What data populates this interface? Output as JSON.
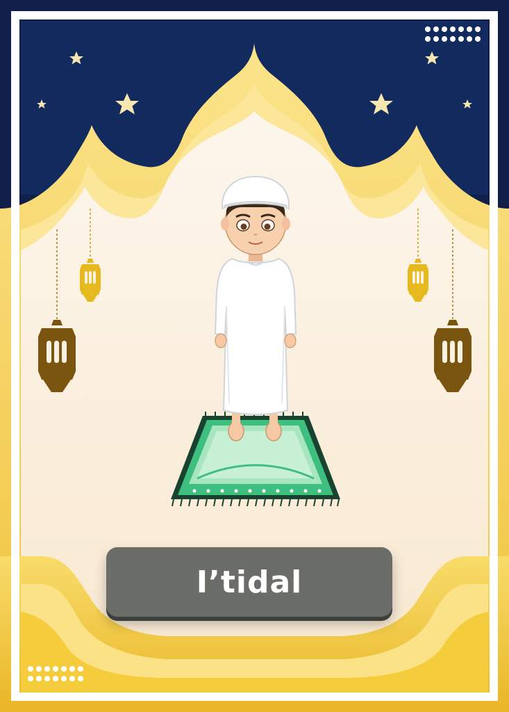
{
  "card": {
    "title": "I’tidal"
  },
  "colors": {
    "sky": "#0f1f4a",
    "gold": "#f3cc3b",
    "gold_light": "#fbe38a",
    "cream": "#fbf1e2",
    "lantern_gold": "#e6b91e",
    "lantern_brown": "#7a5510",
    "mat_green": "#3fbf7f",
    "mat_dark": "#17432f",
    "label_bg": "#6b6d69"
  },
  "icons": [
    "star-icon",
    "dot-grid-icon",
    "lantern-icon",
    "prayer-mat-icon"
  ]
}
